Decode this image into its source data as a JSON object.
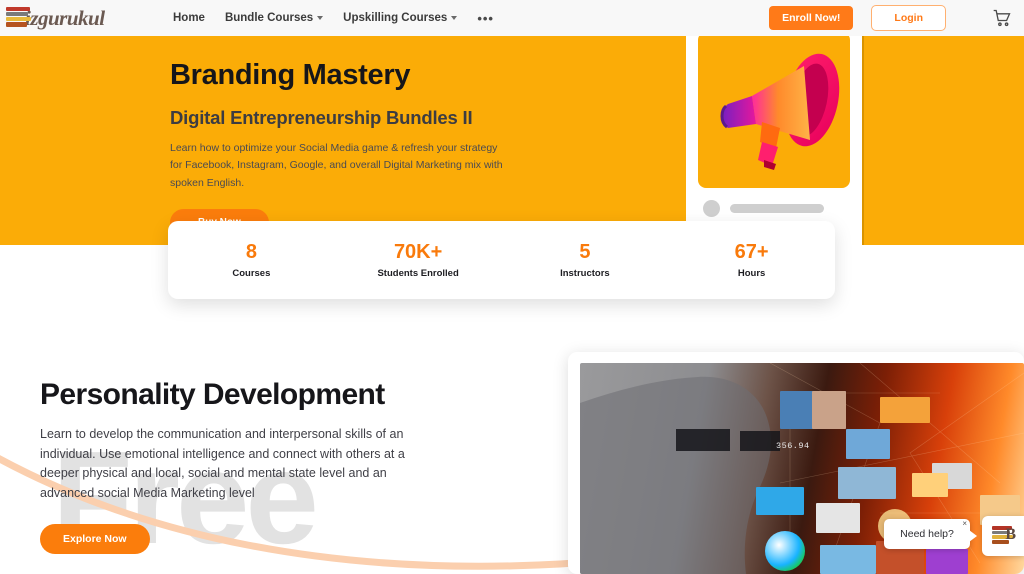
{
  "nav": {
    "logo_text": "izgurukul",
    "logo_icon": "stacked-books-icon",
    "links": [
      {
        "label": "Home",
        "has_caret": false
      },
      {
        "label": "Bundle Courses",
        "has_caret": true
      },
      {
        "label": "Upskilling Courses",
        "has_caret": true
      }
    ],
    "more_label": "•••",
    "enroll_label": "Enroll Now!",
    "login_label": "Login",
    "cart_icon": "shopping-cart-icon"
  },
  "hero": {
    "title": "Branding Mastery",
    "subtitle": "Digital Entrepreneurship Bundles II",
    "description": "Learn how to optimize your Social Media game & refresh your strategy for Facebook, Instagram, Google, and overall Digital Marketing mix with spoken English.",
    "buy_label": "Buy Now",
    "slide_image": "megaphone-image",
    "background_color": "#fbac07",
    "accent_color": "#fb7d0c"
  },
  "stats": [
    {
      "value": "8",
      "label": "Courses"
    },
    {
      "value": "70K+",
      "label": "Students Enrolled"
    },
    {
      "value": "5",
      "label": "Instructors"
    },
    {
      "value": "67+",
      "label": "Hours"
    }
  ],
  "section": {
    "watermark": "Free",
    "title": "Personality Development",
    "description": "Learn to develop the communication and interpersonal skills of an individual. Use emotional intelligence and connect with others at a deeper physical and local, social and mental state level and an advanced social Media Marketing level",
    "explore_label": "Explore Now",
    "media_image": "man-with-digital-media-overlay-image",
    "media_overlay_number": "356.94"
  },
  "chat": {
    "bubble_text": "Need help?",
    "close_label": "×",
    "badge_icon": "bizgurukul-books-logo-icon"
  }
}
